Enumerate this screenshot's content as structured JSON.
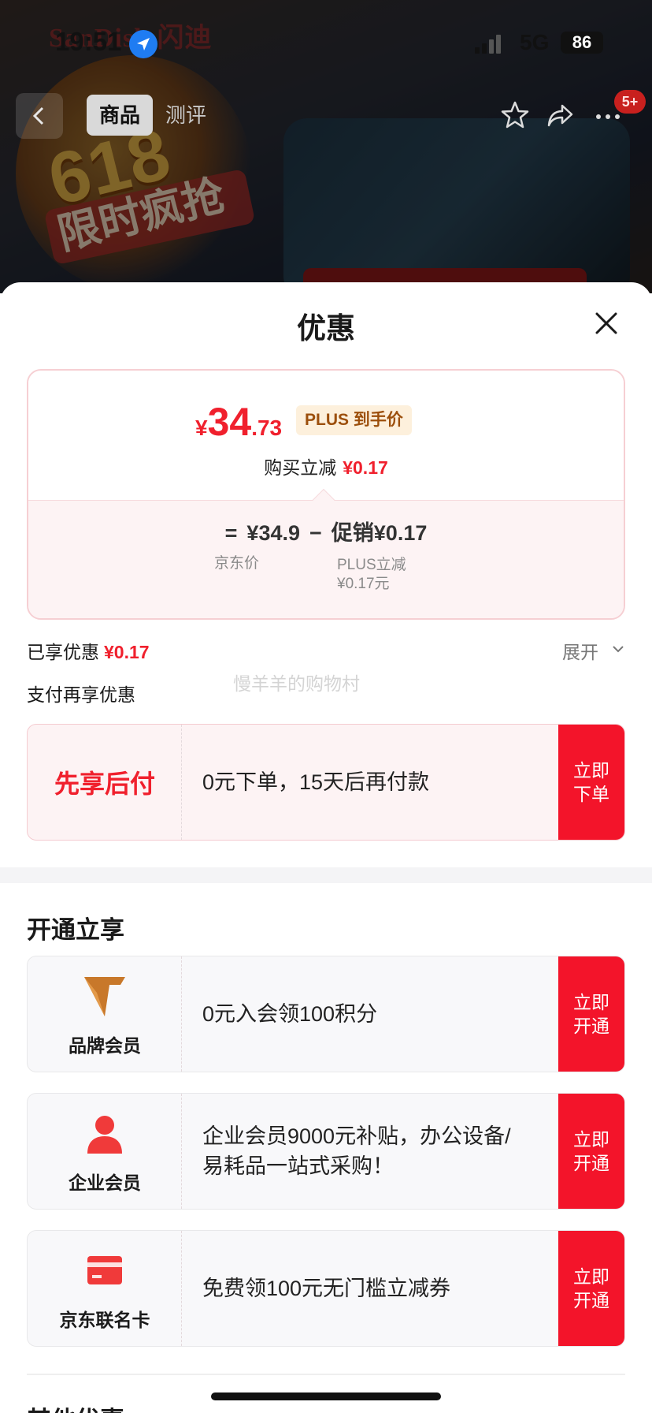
{
  "status_bar": {
    "time": "19:51",
    "network": "5G",
    "battery": "86"
  },
  "backdrop": {
    "logo_text": "SanDisk 闪迪",
    "banner_number": "618",
    "banner_text": "限时疯抢"
  },
  "top_nav": {
    "tabs": [
      {
        "label": "商品",
        "active": true
      },
      {
        "label": "测评",
        "active": false
      }
    ],
    "badge": "5+"
  },
  "sheet": {
    "title": "优惠",
    "price_card": {
      "currency": "¥",
      "price_int": "34",
      "price_dec": ".73",
      "price_tag": "PLUS 到手价",
      "reduce_label": "购买立减",
      "reduce_value": "¥0.17",
      "equals": "=",
      "jd_price": "¥34.9",
      "minus": "−",
      "promo_label": "促销",
      "promo_value": "¥0.17",
      "jd_price_caption": "京东价",
      "promo_caption_1": "PLUS立减",
      "promo_caption_2": "¥0.17元"
    },
    "enjoyed_label": "已享优惠",
    "enjoyed_value": "¥0.17",
    "expand_label": "展开",
    "watermark": "慢羊羊的购物村",
    "pay_more_label": "支付再享优惠",
    "pay_later": {
      "label": "先享后付",
      "desc": "0元下单，15天后再付款",
      "button": "立即下单"
    },
    "membership_title": "开通立享",
    "memberships": [
      {
        "label": "品牌会员",
        "icon": "brand-v-icon",
        "desc": "0元入会领100积分",
        "button": "立即开通"
      },
      {
        "label": "企业会员",
        "icon": "person-icon",
        "desc": "企业会员9000元补贴，办公设备/易耗品一站式采购！",
        "button": "立即开通"
      },
      {
        "label": "京东联名卡",
        "icon": "card-icon",
        "desc": "免费领100元无门槛立减券",
        "button": "立即开通"
      }
    ],
    "other_title": "其他优惠"
  },
  "colors": {
    "accent_red": "#f0202d",
    "button_red": "#f3142a",
    "plus_gold": "#9c4f0c"
  }
}
